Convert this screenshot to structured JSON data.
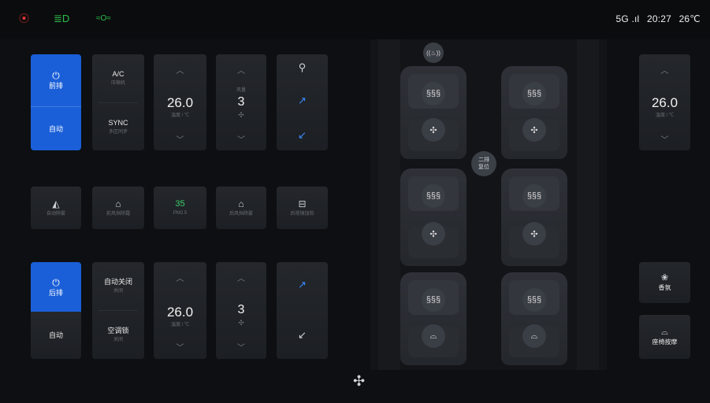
{
  "status_bar": {
    "icons": [
      {
        "name": "camera-record-icon",
        "glyph": "⦿",
        "color": "#e03131"
      },
      {
        "name": "headlight-icon",
        "glyph": "≣D",
        "color": "#2fbf4a"
      },
      {
        "name": "position-light-icon",
        "glyph": "≈O≈",
        "color": "#2fbf4a"
      }
    ],
    "signal": "5G .ıl",
    "time": "20:27",
    "outside_temp": "26℃"
  },
  "front": {
    "power_label": "前排",
    "mode_label": "自动",
    "ac_label": "A/C",
    "ac_sub": "压缩机",
    "sync_label": "SYNC",
    "sync_sub": "多区同步",
    "temp_value": "26.0",
    "temp_unit": "温度 / ℃",
    "fan_level": "3",
    "fan_sub": "风量"
  },
  "middle_row": {
    "auto_defog_label": "自动除雾",
    "front_defrost_label": "前风挡除霜",
    "pm_value": "35",
    "pm_label": "PM2.5",
    "rear_defrost_label": "后风挡除雾",
    "rear_mirror_label": "后视镜加热"
  },
  "rear": {
    "power_label": "后排",
    "mode_label": "自动",
    "auto_off_label": "自动关闭",
    "auto_off_sub": "关闭",
    "lock_label": "空调锁",
    "lock_sub": "关闭",
    "temp_value": "26.0",
    "temp_unit": "温度 / ℃",
    "fan_level": "3"
  },
  "right_panel": {
    "temp_value": "26.0",
    "temp_unit": "温度 / ℃",
    "fragrance_label": "香氛",
    "massage_label": "座椅按摩"
  },
  "seatmap": {
    "center_tag": [
      "二排",
      "复位"
    ],
    "steering_heat_glyph": "((♨))",
    "heat_glyph": "§§§",
    "vent_glyph": "✣",
    "massage_glyph": "⌓"
  },
  "colors": {
    "accent_blue": "#1a5fd8",
    "pm_green": "#3ccf6b",
    "vent_blue": "#3b8cff"
  }
}
